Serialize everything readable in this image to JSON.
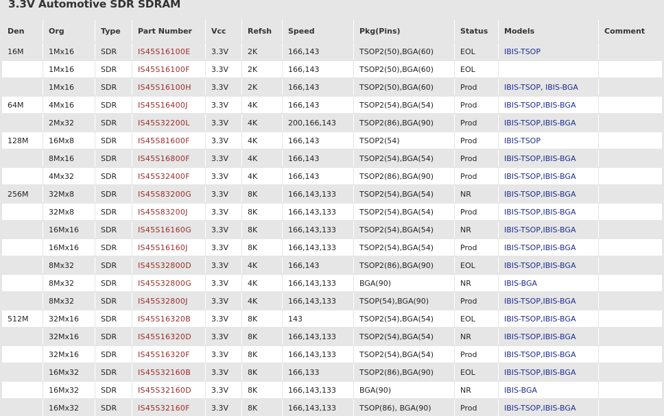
{
  "title": "3.3V Automotive SDR SDRAM",
  "columns": [
    "Den",
    "Org",
    "Type",
    "Part Number",
    "Vcc",
    "Refsh",
    "Speed",
    "Pkg(Pins)",
    "Status",
    "Models",
    "Comment"
  ],
  "rows": [
    {
      "den": "16M",
      "org": "1Mx16",
      "type": "SDR",
      "part": "IS45S16100E",
      "vcc": "3.3V",
      "refsh": "2K",
      "speed": "166,143",
      "pkg": "TSOP2(50),BGA(60)",
      "status": "EOL",
      "models": "IBIS-TSOP",
      "comment": ""
    },
    {
      "den": "",
      "org": "1Mx16",
      "type": "SDR",
      "part": "IS45S16100F",
      "vcc": "3.3V",
      "refsh": "2K",
      "speed": "166,143",
      "pkg": "TSOP2(50),BGA(60)",
      "status": "EOL",
      "models": "",
      "comment": ""
    },
    {
      "den": "",
      "org": "1Mx16",
      "type": "SDR",
      "part": "IS45S16100H",
      "vcc": "3.3V",
      "refsh": "2K",
      "speed": "166,143",
      "pkg": "TSOP2(50),BGA(60)",
      "status": "Prod",
      "models": "IBIS-TSOP, IBIS-BGA",
      "comment": ""
    },
    {
      "den": "64M",
      "org": "4Mx16",
      "type": "SDR",
      "part": "IS45S16400J",
      "vcc": "3.3V",
      "refsh": "4K",
      "speed": "166,143",
      "pkg": "TSOP2(54),BGA(54)",
      "status": "Prod",
      "models": "IBIS-TSOP,IBIS-BGA",
      "comment": ""
    },
    {
      "den": "",
      "org": "2Mx32",
      "type": "SDR",
      "part": "IS45S32200L",
      "vcc": "3.3V",
      "refsh": "4K",
      "speed": "200,166,143",
      "pkg": "TSOP2(86),BGA(90)",
      "status": "Prod",
      "models": "IBIS-TSOP,IBIS-BGA",
      "comment": ""
    },
    {
      "den": "128M",
      "org": "16Mx8",
      "type": "SDR",
      "part": "IS45S81600F",
      "vcc": "3.3V",
      "refsh": "4K",
      "speed": "166,143",
      "pkg": "TSOP2(54)",
      "status": "Prod",
      "models": "IBIS-TSOP",
      "comment": ""
    },
    {
      "den": "",
      "org": "8Mx16",
      "type": "SDR",
      "part": "IS45S16800F",
      "vcc": "3.3V",
      "refsh": "4K",
      "speed": "166,143",
      "pkg": "TSOP2(54),BGA(54)",
      "status": "Prod",
      "models": "IBIS-TSOP,IBIS-BGA",
      "comment": ""
    },
    {
      "den": "",
      "org": "4Mx32",
      "type": "SDR",
      "part": "IS45S32400F",
      "vcc": "3.3V",
      "refsh": "4K",
      "speed": "166,143",
      "pkg": "TSOP2(86),BGA(90)",
      "status": "Prod",
      "models": "IBIS-TSOP,IBIS-BGA",
      "comment": ""
    },
    {
      "den": "256M",
      "org": "32Mx8",
      "type": "SDR",
      "part": "IS45S83200G",
      "vcc": "3.3V",
      "refsh": "8K",
      "speed": "166,143,133",
      "pkg": "TSOP2(54),BGA(54)",
      "status": "NR",
      "models": "IBIS-TSOP,IBIS-BGA",
      "comment": ""
    },
    {
      "den": "",
      "org": "32Mx8",
      "type": "SDR",
      "part": "IS45S83200J",
      "vcc": "3.3V",
      "refsh": "8K",
      "speed": "166,143,133",
      "pkg": "TSOP2(54),BGA(54)",
      "status": "Prod",
      "models": "IBIS-TSOP,IBIS-BGA",
      "comment": ""
    },
    {
      "den": "",
      "org": "16Mx16",
      "type": "SDR",
      "part": "IS45S16160G",
      "vcc": "3.3V",
      "refsh": "8K",
      "speed": "166,143,133",
      "pkg": "TSOP2(54),BGA(54)",
      "status": "NR",
      "models": "IBIS-TSOP,IBIS-BGA",
      "comment": ""
    },
    {
      "den": "",
      "org": "16Mx16",
      "type": "SDR",
      "part": "IS45S16160J",
      "vcc": "3.3V",
      "refsh": "8K",
      "speed": "166,143,133",
      "pkg": "TSOP2(54),BGA(54)",
      "status": "Prod",
      "models": "IBIS-TSOP,IBIS-BGA",
      "comment": ""
    },
    {
      "den": "",
      "org": "8Mx32",
      "type": "SDR",
      "part": "IS45S32800D",
      "vcc": "3.3V",
      "refsh": "4K",
      "speed": "166,143",
      "pkg": "TSOP2(86),BGA(90)",
      "status": "EOL",
      "models": "IBIS-TSOP,IBIS-BGA",
      "comment": ""
    },
    {
      "den": "",
      "org": "8Mx32",
      "type": "SDR",
      "part": "IS45S32800G",
      "vcc": "3.3V",
      "refsh": "4K",
      "speed": "166,143,133",
      "pkg": "BGA(90)",
      "status": "NR",
      "models": "IBIS-BGA",
      "comment": ""
    },
    {
      "den": "",
      "org": "8Mx32",
      "type": "SDR",
      "part": "IS45S32800J",
      "vcc": "3.3V",
      "refsh": "4K",
      "speed": "166,143,133",
      "pkg": "TSOP(54),BGA(90)",
      "status": "Prod",
      "models": "IBIS-TSOP,IBIS-BGA",
      "comment": ""
    },
    {
      "den": "512M",
      "org": "32Mx16",
      "type": "SDR",
      "part": "IS45S16320B",
      "vcc": "3.3V",
      "refsh": "8K",
      "speed": "143",
      "pkg": "TSOP2(54),BGA(54)",
      "status": "EOL",
      "models": "IBIS-TSOP,IBIS-BGA",
      "comment": ""
    },
    {
      "den": "",
      "org": "32Mx16",
      "type": "SDR",
      "part": "IS45S16320D",
      "vcc": "3.3V",
      "refsh": "8K",
      "speed": "166,143,133",
      "pkg": "TSOP2(54),BGA(54)",
      "status": "NR",
      "models": "IBIS-TSOP,IBIS-BGA",
      "comment": ""
    },
    {
      "den": "",
      "org": "32Mx16",
      "type": "SDR",
      "part": "IS45S16320F",
      "vcc": "3.3V",
      "refsh": "8K",
      "speed": "166,143,133",
      "pkg": "TSOP2(54),BGA(54)",
      "status": "Prod",
      "models": "IBIS-TSOP,IBIS-BGA",
      "comment": ""
    },
    {
      "den": "",
      "org": "16Mx32",
      "type": "SDR",
      "part": "IS45S32160B",
      "vcc": "3.3V",
      "refsh": "8K",
      "speed": "166,133",
      "pkg": "TSOP2(86),BGA(90)",
      "status": "EOL",
      "models": "IBIS-TSOP,IBIS-BGA",
      "comment": ""
    },
    {
      "den": "",
      "org": "16Mx32",
      "type": "SDR",
      "part": "IS45S32160D",
      "vcc": "3.3V",
      "refsh": "8K",
      "speed": "166,143,133",
      "pkg": "BGA(90)",
      "status": "NR",
      "models": "IBIS-BGA",
      "comment": ""
    },
    {
      "den": "",
      "org": "16Mx32",
      "type": "SDR",
      "part": "IS45S32160F",
      "vcc": "3.3V",
      "refsh": "8K",
      "speed": "166,143,133",
      "pkg": "TSOP(86), BGA(90)",
      "status": "Prod",
      "models": "IBIS-TSOP,IBIS-BGA",
      "comment": ""
    }
  ],
  "colors": {
    "background": "#e6e6e6",
    "row_light": "#ffffff",
    "part_number": "#9c2a2a",
    "model_link": "#1d2b8f"
  }
}
